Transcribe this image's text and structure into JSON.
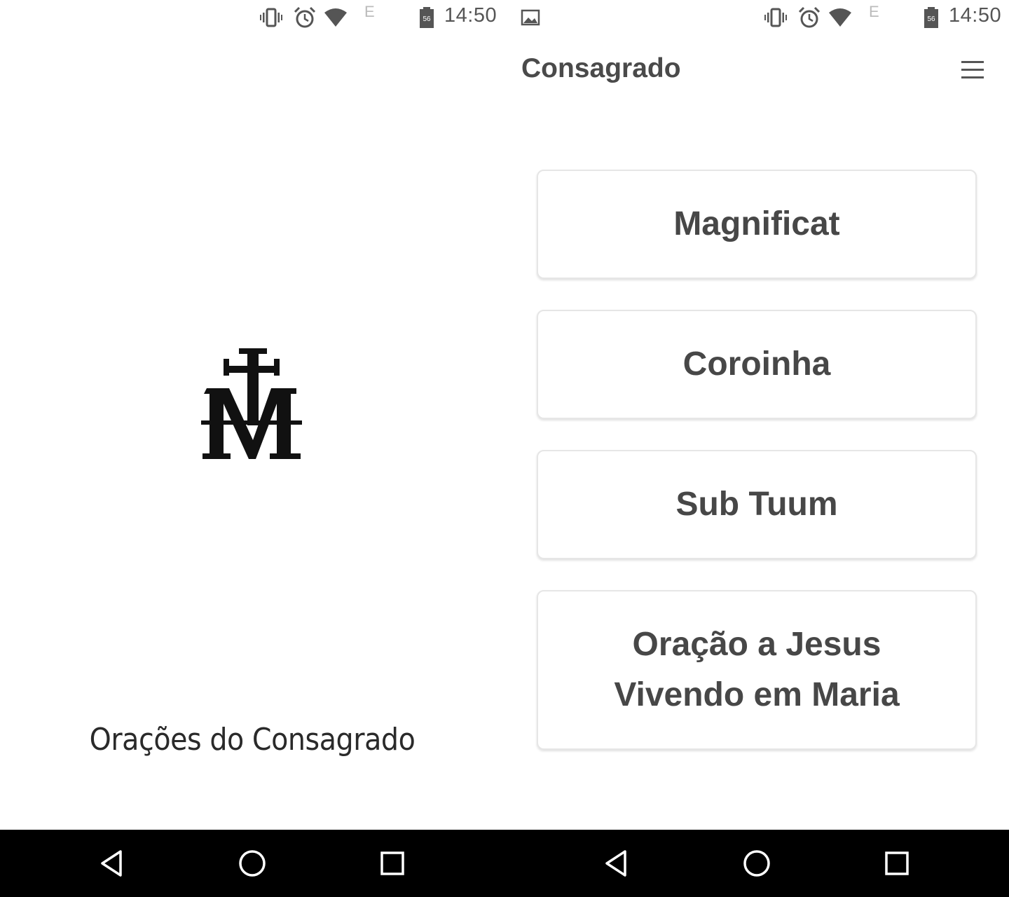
{
  "status_bar": {
    "time": "14:50",
    "network_label": "E",
    "battery_level": "56",
    "icons": [
      "vibrate-icon",
      "alarm-icon",
      "wifi-icon",
      "battery-icon",
      "image-notification-icon"
    ]
  },
  "splash": {
    "logo": "marian-monogram-logo",
    "title": "Orações do Consagrado"
  },
  "app": {
    "header_title": "Consagrado",
    "menu_icon": "hamburger-menu-icon",
    "prayers": [
      {
        "label": "Magnificat"
      },
      {
        "label": "Coroinha"
      },
      {
        "label": "Sub Tuum"
      },
      {
        "label": "Oração a Jesus Vivendo em Maria"
      }
    ]
  },
  "nav_bar": {
    "buttons": [
      "back-icon",
      "home-icon",
      "recents-icon"
    ]
  },
  "colors": {
    "text": "#4a4a4a",
    "button_border": "#e6e6e6",
    "nav_background": "#000000"
  }
}
